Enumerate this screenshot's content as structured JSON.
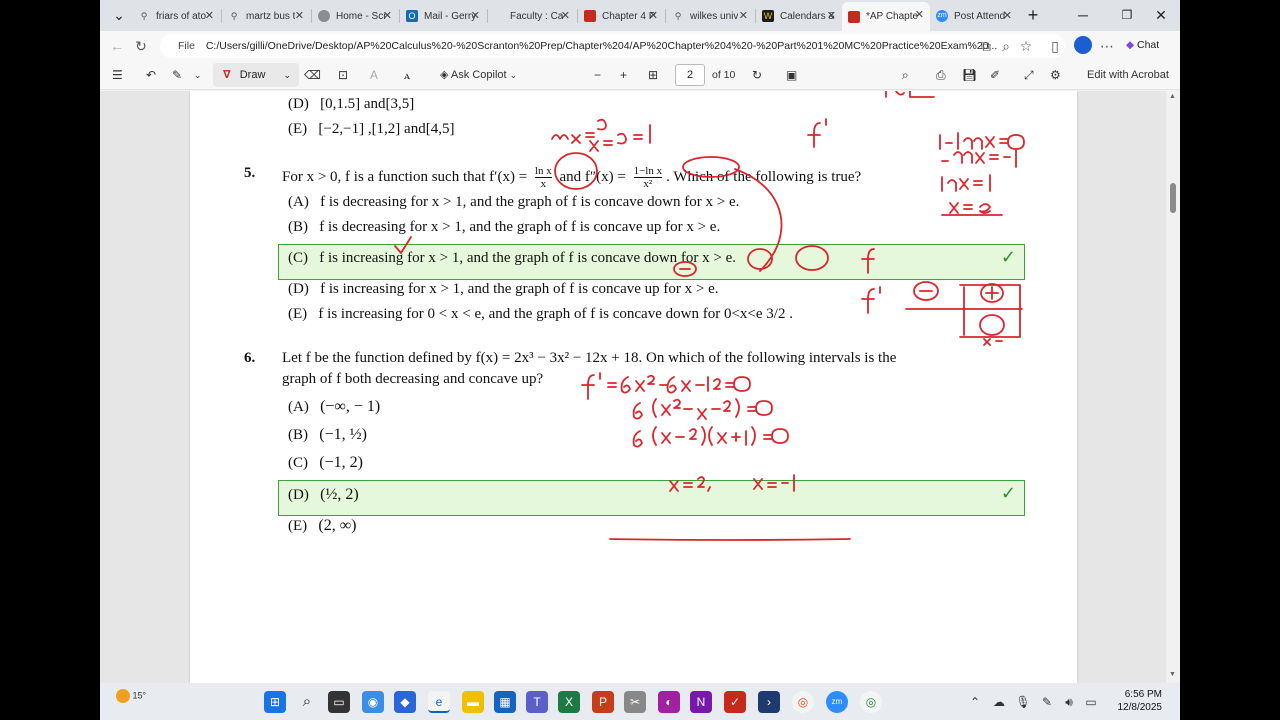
{
  "tabs": [
    {
      "label": "friars of ato",
      "icon": "search-icon"
    },
    {
      "label": "martz bus t",
      "icon": "search-icon"
    },
    {
      "label": "Home - Scr",
      "icon": "globe-icon"
    },
    {
      "label": "Mail - Gerry",
      "icon": "outlook-icon"
    },
    {
      "label": "Faculty : Ca",
      "icon": "page-icon"
    },
    {
      "label": "Chapter 4 P",
      "icon": "pdf-icon"
    },
    {
      "label": "wilkes univ",
      "icon": "search-icon"
    },
    {
      "label": "Calendars &",
      "icon": "calendar-icon"
    },
    {
      "label": "*AP Chapte",
      "icon": "pdf-icon"
    },
    {
      "label": "Post Attend",
      "icon": "zoom-icon"
    }
  ],
  "address": {
    "prefix": "File",
    "url": "C:/Users/gilli/OneDrive/Desktop/AP%20Calculus%20-%20Scranton%20Prep/Chapter%204/AP%20Chapter%204%20-%20Part%201%20MC%20Practice%20Exam%20..."
  },
  "browser": {
    "chat_label": "Chat"
  },
  "toolbar": {
    "draw_label": "Draw",
    "ask_copilot_label": "Ask Copilot",
    "page_current": "2",
    "page_total": "of 10",
    "edit_acrobat_label": "Edit with Acrobat"
  },
  "document": {
    "q4_d": {
      "letter": "(D)",
      "text": "[0,1.5] and[3,5]"
    },
    "q4_e": {
      "letter": "(E)",
      "text": "[−2,−1] ,[1,2] and[4,5]"
    },
    "q5": {
      "number": "5.",
      "stem_a": "For x > 0, f is a function such that f′(x) =",
      "frac1_num": "ln x",
      "frac1_den": "x",
      "stem_b": "and f″(x) =",
      "frac2_num": "1−ln x",
      "frac2_den": "x²",
      "stem_c": ". Which of the following is true?",
      "choices": [
        {
          "letter": "(A)",
          "text": "f is decreasing for x > 1, and the graph of f is concave down for x > e."
        },
        {
          "letter": "(B)",
          "text": "f is decreasing for x > 1, and the graph of f is concave up for x > e."
        },
        {
          "letter": "(C)",
          "text": "f is increasing for x > 1, and the graph of f is concave down for x > e."
        },
        {
          "letter": "(D)",
          "text": "f is increasing for x > 1, and the graph of f is concave up for x > e."
        },
        {
          "letter": "(E)",
          "text": "f is increasing for 0 < x < e, and the graph of f is concave down for 0<x<e 3/2 ."
        }
      ]
    },
    "q6": {
      "number": "6.",
      "stem_line1": "Let f be the function defined by f(x) = 2x³ − 3x² − 12x + 18. On which of the following intervals is the",
      "stem_line2": "graph of f both decreasing and concave up?",
      "choices": [
        {
          "letter": "(A)",
          "text": "(−∞, − 1)"
        },
        {
          "letter": "(B)",
          "text": "(−1, ½)"
        },
        {
          "letter": "(C)",
          "text": "(−1, 2)"
        },
        {
          "letter": "(D)",
          "text": "(½, 2)"
        },
        {
          "letter": "(E)",
          "text": "(2, ∞)"
        }
      ]
    }
  },
  "taskbar": {
    "weather": "15°",
    "time": "6:56 PM",
    "date": "12/8/2025"
  }
}
